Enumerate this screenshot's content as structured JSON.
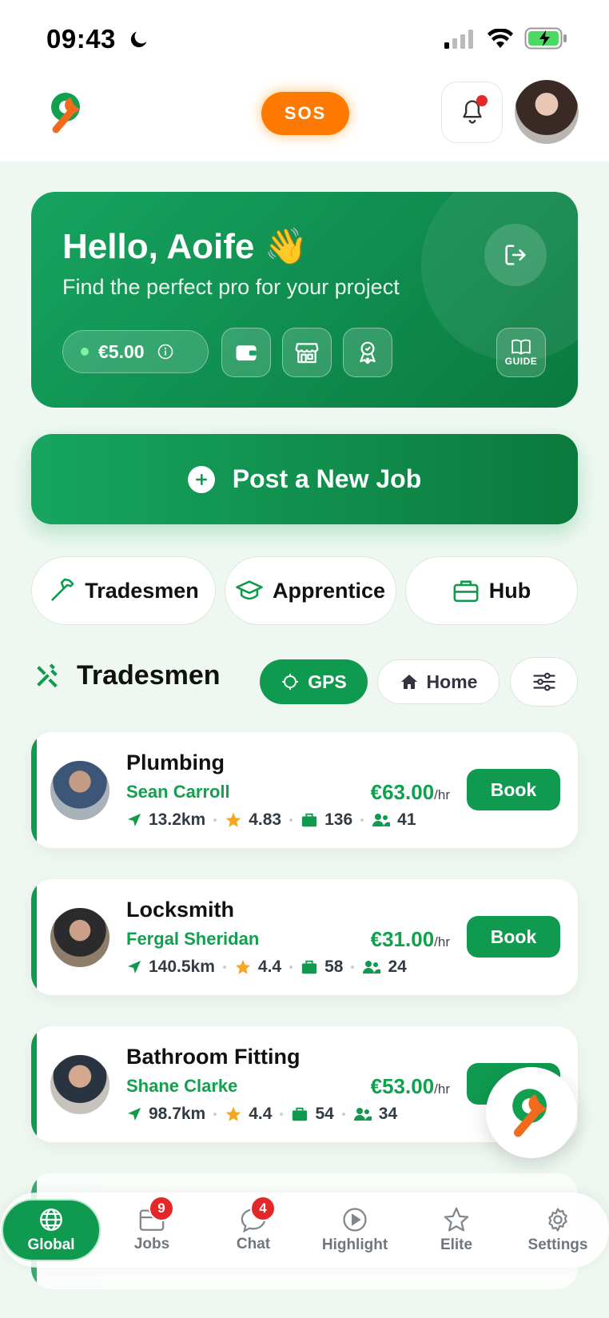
{
  "status_bar": {
    "time": "09:43"
  },
  "top_nav": {
    "sos_label": "SOS"
  },
  "hero": {
    "greeting": "Hello, Aoife 👋",
    "subtitle": "Find the perfect pro for your project",
    "balance": "€5.00",
    "guide_label": "GUIDE"
  },
  "post_job_label": "Post a New Job",
  "segments": [
    {
      "label": "Tradesmen",
      "icon": "hammer-icon"
    },
    {
      "label": "Apprentice",
      "icon": "graduation-cap-icon"
    },
    {
      "label": "Hub",
      "icon": "briefcase-icon"
    }
  ],
  "section": {
    "title": "Tradesmen",
    "gps_label": "GPS",
    "home_label": "Home"
  },
  "tradesmen": [
    {
      "trade": "Plumbing",
      "name": "Sean Carroll",
      "price": "€63.00",
      "unit": "/hr",
      "distance": "13.2km",
      "rating": "4.83",
      "jobs": "136",
      "followers": "41",
      "book": "Book"
    },
    {
      "trade": "Locksmith",
      "name": "Fergal Sheridan",
      "price": "€31.00",
      "unit": "/hr",
      "distance": "140.5km",
      "rating": "4.4",
      "jobs": "58",
      "followers": "24",
      "book": "Book"
    },
    {
      "trade": "Bathroom Fitting",
      "name": "Shane Clarke",
      "price": "€53.00",
      "unit": "/hr",
      "distance": "98.7km",
      "rating": "4.4",
      "jobs": "54",
      "followers": "34",
      "book": "B"
    }
  ],
  "bottom_nav": [
    {
      "label": "Global",
      "icon": "globe-icon",
      "active": true
    },
    {
      "label": "Jobs",
      "icon": "folder-icon",
      "badge": "9"
    },
    {
      "label": "Chat",
      "icon": "chat-icon",
      "badge": "4"
    },
    {
      "label": "Highlight",
      "icon": "play-icon"
    },
    {
      "label": "Elite",
      "icon": "star-icon"
    },
    {
      "label": "Settings",
      "icon": "gear-icon"
    }
  ],
  "colors": {
    "brand_green": "#0f9a4f",
    "sos_orange": "#ff7a00",
    "badge_red": "#e4282a"
  }
}
